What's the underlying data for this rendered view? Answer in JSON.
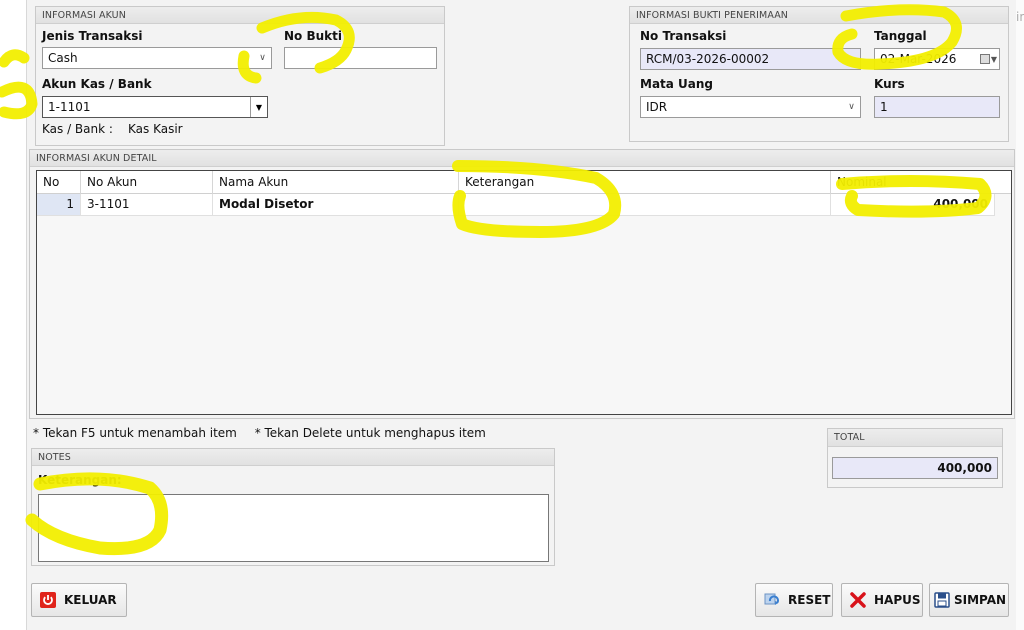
{
  "informasi_akun": {
    "title": "INFORMASI AKUN",
    "jenis_transaksi_label": "Jenis Transaksi",
    "jenis_transaksi_value": "Cash",
    "no_bukti_label": "No Bukti",
    "no_bukti_value": "",
    "akun_kas_label": "Akun Kas / Bank",
    "akun_kas_value": "1-1101",
    "kas_bank_label": "Kas / Bank :",
    "kas_bank_value": "Kas Kasir"
  },
  "informasi_bukti": {
    "title": "INFORMASI BUKTI PENERIMAAN",
    "no_transaksi_label": "No Transaksi",
    "no_transaksi_value": "RCM/03-2026-00002",
    "tanggal_label": "Tanggal",
    "tanggal_value": "02-Mar-2026",
    "mata_uang_label": "Mata Uang",
    "mata_uang_value": "IDR",
    "kurs_label": "Kurs",
    "kurs_value": "1"
  },
  "detail": {
    "title": "INFORMASI AKUN DETAIL",
    "columns": [
      "No",
      "No Akun",
      "Nama Akun",
      "Keterangan",
      "Nominal"
    ],
    "rows": [
      {
        "no": "1",
        "no_akun": "3-1101",
        "nama_akun": "Modal Disetor",
        "keterangan": "",
        "nominal": "400,000"
      }
    ]
  },
  "hints": {
    "f5": "* Tekan F5 untuk menambah item",
    "delete": "* Tekan Delete untuk menghapus item"
  },
  "notes": {
    "title": "NOTES",
    "keterangan_label": "Keterangan:",
    "keterangan_value": ""
  },
  "total": {
    "title": "TOTAL",
    "value": "400,000"
  },
  "buttons": {
    "keluar": "KELUAR",
    "reset": "RESET",
    "hapus": "HAPUS",
    "simpan": "SIMPAN"
  },
  "icons": {
    "keluar": "power-icon",
    "reset": "refresh-icon",
    "hapus": "delete-x-icon",
    "simpan": "floppy-disk-icon"
  },
  "colors": {
    "highlight": "#f2ee00",
    "readonly_field": "#e8e8f8",
    "power_red": "#e0241b",
    "delete_red": "#d8121a",
    "refresh_blue": "#3a7fd0"
  }
}
